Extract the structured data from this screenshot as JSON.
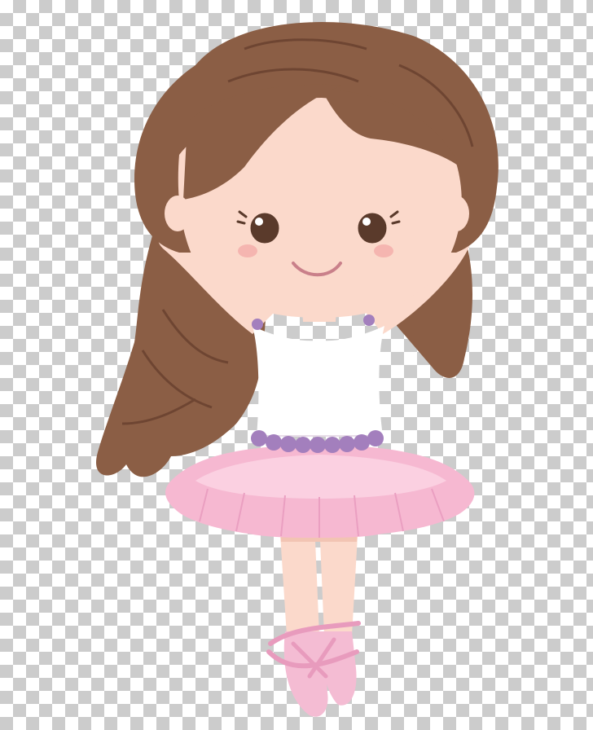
{
  "image": {
    "subject": "ballerina-girl-clipart",
    "background": "transparency-checkerboard"
  },
  "colors": {
    "hair": "#8b5e45",
    "hair_dark": "#6e4532",
    "skin": "#fbd9cb",
    "skin_shadow": "#f2c4b3",
    "leotard": "#ffffff",
    "strap_beads": "#a37fbd",
    "tutu": "#f6b8d1",
    "tutu_light": "#fbd0e1",
    "shoe": "#f4bcd3",
    "eye": "#5a3a2b",
    "mouth": "#c9808a",
    "blush": "#f5b5b0"
  }
}
